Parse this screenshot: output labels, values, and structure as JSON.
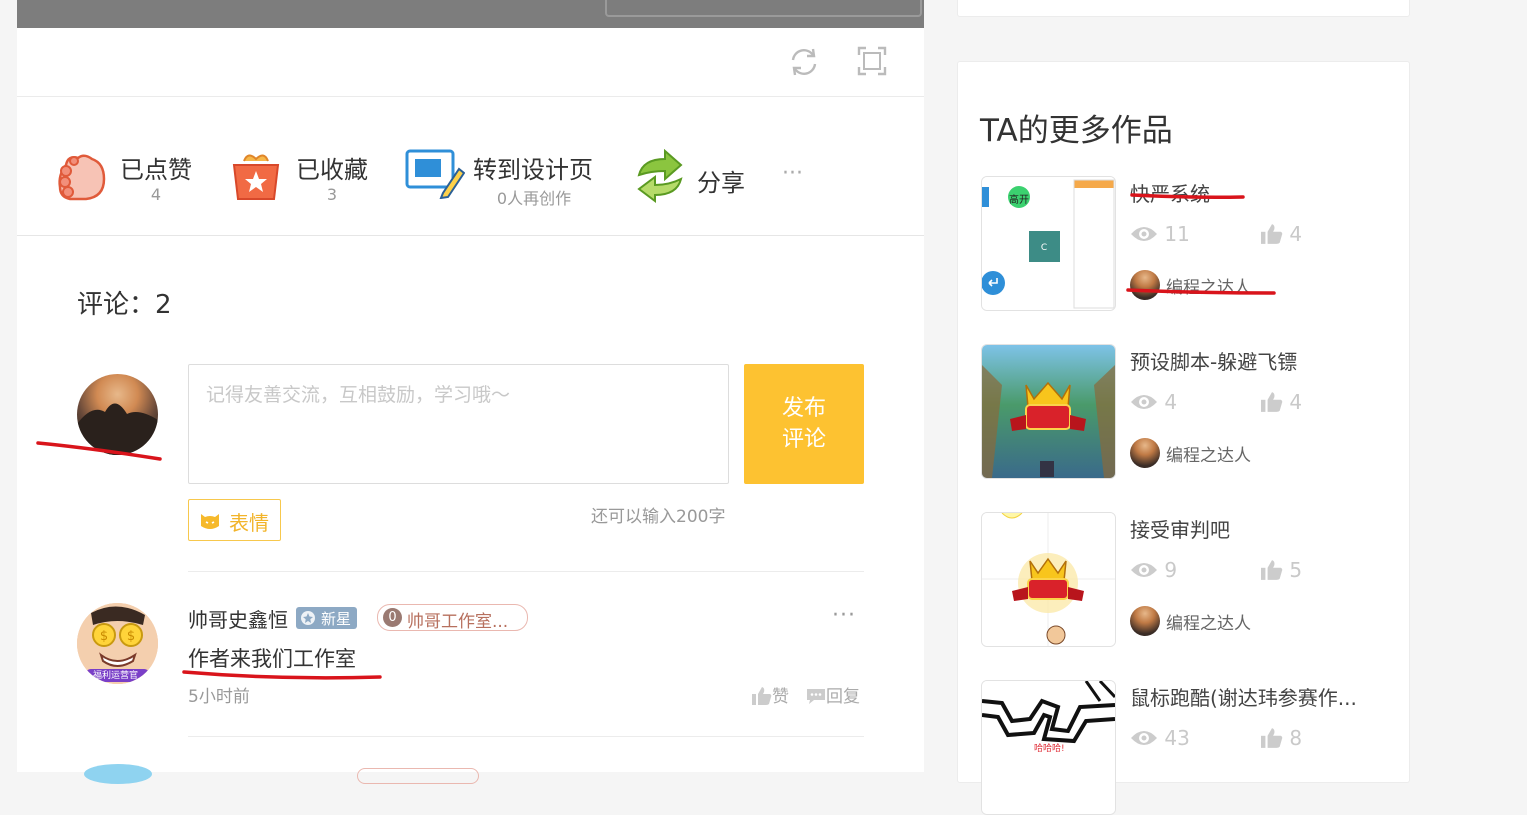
{
  "actions": {
    "like": {
      "label": "已点赞",
      "count": "4"
    },
    "favorite": {
      "label": "已收藏",
      "count": "3"
    },
    "design": {
      "label": "转到设计页",
      "sub": "0人再创作"
    },
    "share": {
      "label": "分享"
    },
    "more": "···"
  },
  "comments": {
    "title": "评论：2",
    "placeholder": "记得友善交流，互相鼓励，学习哦～",
    "publish_label": "发布\n评论",
    "emoji_label": "表情",
    "counter": "还可以输入200字",
    "items": [
      {
        "author": "帅哥史鑫恒",
        "badge": "新星",
        "studio_number": "0",
        "studio": "帅哥工作室...",
        "avatar_caption": "福利运营官",
        "text": "作者来我们工作室",
        "time": "5小时前",
        "like": "赞",
        "reply": "回复",
        "more": "···"
      }
    ]
  },
  "sidebar": {
    "title": "TA的更多作品",
    "works": [
      {
        "title": "快严系统",
        "views": "11",
        "likes": "4",
        "author": "编程之达人",
        "thumb_label": "高开"
      },
      {
        "title": "预设脚本-躲避飞镖",
        "views": "4",
        "likes": "4",
        "author": "编程之达人"
      },
      {
        "title": "接受审判吧",
        "views": "9",
        "likes": "5",
        "author": "编程之达人"
      },
      {
        "title": "鼠标跑酷(谢达玮参赛作...",
        "views": "43",
        "likes": "8",
        "author": "",
        "thumb_label": "哈哈哈!"
      }
    ]
  },
  "colors": {
    "accent": "#fdc231",
    "annotation": "#d9141b",
    "badge": "#8da9c4"
  }
}
